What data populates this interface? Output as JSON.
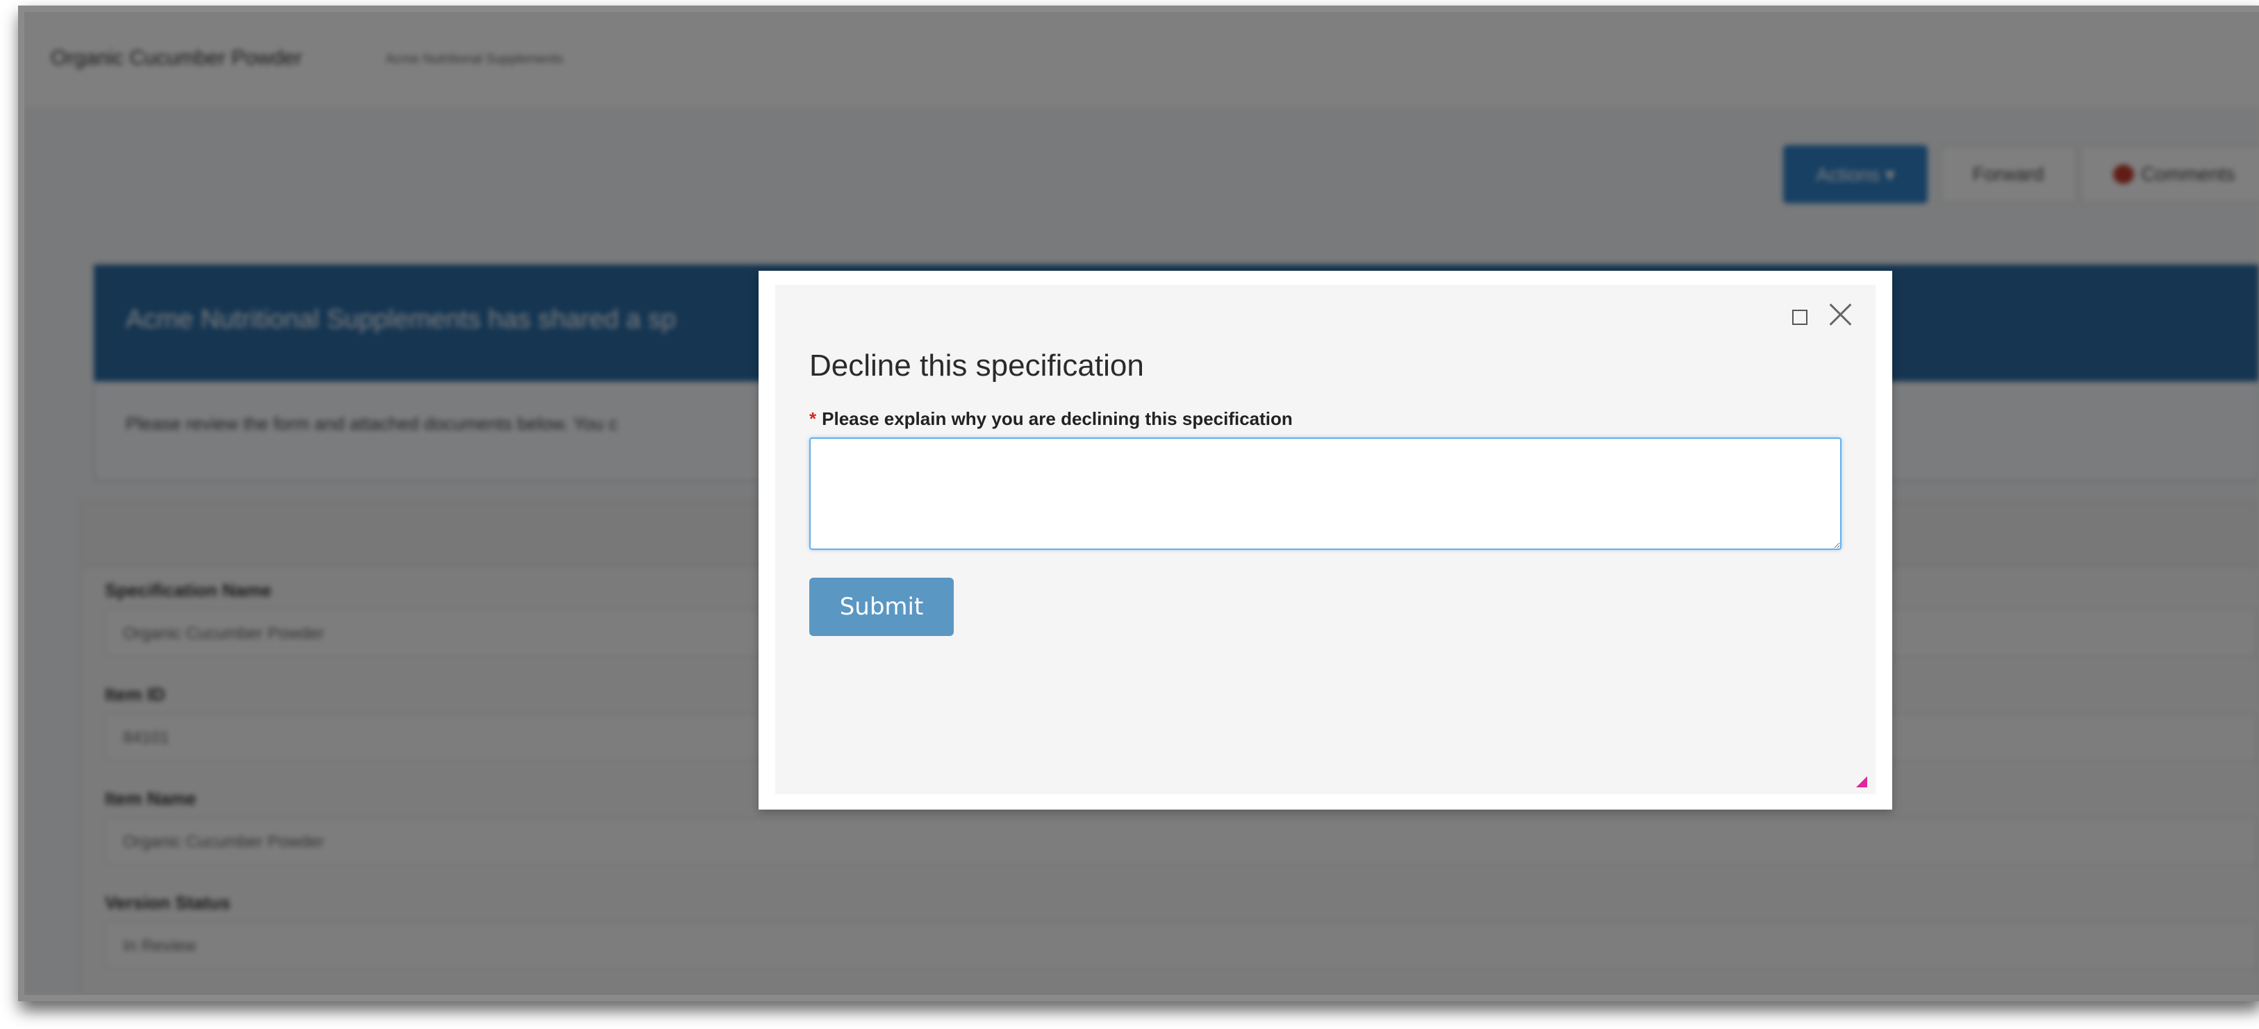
{
  "header": {
    "title": "Organic Cucumber Powder",
    "subtitle": "Acme Nutritional Supplements"
  },
  "toolbar": {
    "actions_label": "Actions ▾",
    "forward_label": "Forward",
    "comments_label": "Comments"
  },
  "banner": {
    "text": "Acme Nutritional Supplements has shared a sp",
    "note": "Please review the form and attached documents below. You c"
  },
  "form": {
    "fields": [
      {
        "label": "Specification Name",
        "value": "Organic Cucumber Powder"
      },
      {
        "label": "Item ID",
        "value": "84101"
      },
      {
        "label": "Item Name",
        "value": "Organic Cucumber Powder"
      },
      {
        "label": "Version Status",
        "value": "In Review"
      }
    ]
  },
  "modal": {
    "title": "Decline this specification",
    "required_marker": "*",
    "field_label": "Please explain why you are declining this specification",
    "reason_value": "",
    "submit_label": "Submit"
  }
}
